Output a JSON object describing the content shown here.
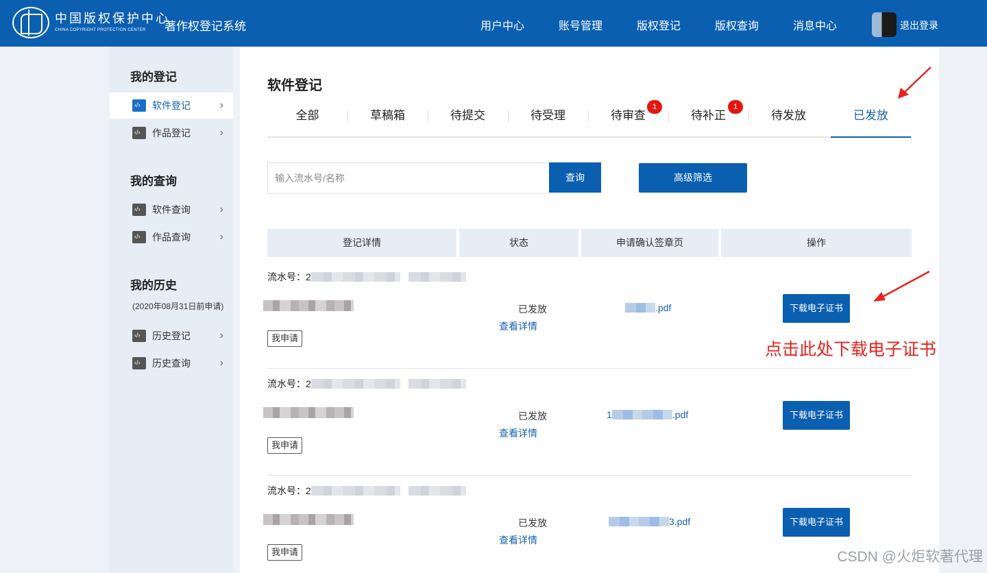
{
  "header": {
    "logo_cn": "中国版权保护中心",
    "logo_en": "CHINA COPYRIGHT PROTECTION CENTER",
    "system_title": "著作权登记系统",
    "nav": [
      "用户中心",
      "账号管理",
      "版权登记",
      "版权查询",
      "消息中心"
    ],
    "logout": "退出登录"
  },
  "sidebar": {
    "sec1_title": "我的登记",
    "item_software_reg": "软件登记",
    "item_work_reg": "作品登记",
    "sec2_title": "我的查询",
    "item_software_query": "软件查询",
    "item_work_query": "作品查询",
    "sec3_title": "我的历史",
    "sec3_note": "(2020年08月31日前申请)",
    "item_history_reg": "历史登记",
    "item_history_query": "历史查询"
  },
  "main": {
    "title": "软件登记",
    "tabs": [
      "全部",
      "草稿箱",
      "待提交",
      "待受理",
      "待审查",
      "待补正",
      "待发放",
      "已发放"
    ],
    "badge_review": "1",
    "badge_correction": "1",
    "search_placeholder": "输入流水号/名称",
    "query_button": "查询",
    "filter_button": "高级筛选",
    "table_headers": [
      "登记详情",
      "状态",
      "申请确认签章页",
      "操作"
    ],
    "rows": [
      {
        "serial_label": "流水号：2",
        "tag": "我申请",
        "status": "已发放",
        "detail_link": "查看详情",
        "pdf": ".pdf",
        "download": "下载电子证书"
      },
      {
        "serial_label": "流水号：2",
        "tag": "我申请",
        "status": "已发放",
        "detail_link": "查看详情",
        "pdf_prefix": "1",
        "pdf": ".pdf",
        "download": "下载电子证书"
      },
      {
        "serial_label": "流水号：2",
        "tag": "我申请",
        "status": "已发放",
        "detail_link": "查看详情",
        "pdf": "3.pdf",
        "download": "下载电子证书"
      }
    ]
  },
  "annotation": "点击此处下载电子证书",
  "watermark": "CSDN @火炬软著代理",
  "colors": {
    "brand": "#0b5fb0",
    "annotation": "#e8221d",
    "badge": "#e4170f"
  }
}
